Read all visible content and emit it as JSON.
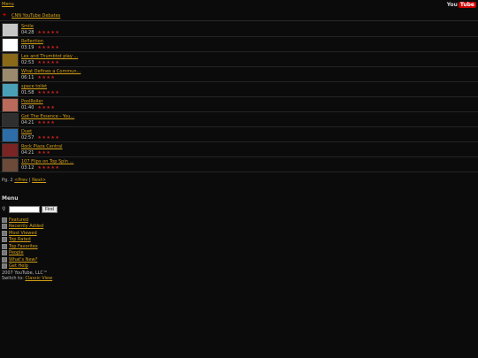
{
  "topbar": {
    "menu_label": "Menu",
    "logo_you": "You",
    "logo_tube": "Tube"
  },
  "playlist": {
    "title": "CNN YouTube Debates"
  },
  "videos": [
    {
      "title": "Smile",
      "duration": "04:28",
      "rating": "★★★★★",
      "thumb_color": "#c7c7c7"
    },
    {
      "title": "Reflection",
      "duration": "03:19",
      "rating": "★★★★★",
      "thumb_color": "#ffffff"
    },
    {
      "title": "Lex and Thumbtot play ...",
      "duration": "02:53",
      "rating": "★★★★★",
      "thumb_color": "#8a6a18"
    },
    {
      "title": "What Defines a Commun...",
      "duration": "06:11",
      "rating": "★★★★",
      "thumb_color": "#9c8a6e"
    },
    {
      "title": "space toilet",
      "duration": "01:58",
      "rating": "★★★★★",
      "thumb_color": "#4aa1b7"
    },
    {
      "title": "PoolRoller",
      "duration": "01:40",
      "rating": "★★★★",
      "thumb_color": "#b96a5b"
    },
    {
      "title": "Got The Essence - You...",
      "duration": "04:21",
      "rating": "★★★★",
      "thumb_color": "#2f2f2f"
    },
    {
      "title": "Duet",
      "duration": "02:57",
      "rating": "★★★★★",
      "thumb_color": "#2d6ea8"
    },
    {
      "title": "Rock Plaza Central",
      "duration": "04:21",
      "rating": "★★★",
      "thumb_color": "#7a2424"
    },
    {
      "title": "107 Flips on Top Spin ...",
      "duration": "03:12",
      "rating": "★★★★★",
      "thumb_color": "#6b4a3a"
    }
  ],
  "pager": {
    "page_text": "Pg. 2",
    "prev_label": "<Prev",
    "sep": "|",
    "next_label": "Next>"
  },
  "menu": {
    "title": "Menu",
    "search_button": "Find",
    "items": [
      {
        "label": "Featured"
      },
      {
        "label": "Recently Added"
      },
      {
        "label": "Most Viewed"
      },
      {
        "label": "Top Rated"
      },
      {
        "label": "Top Favorites"
      },
      {
        "label": "People"
      },
      {
        "label": "What's New?"
      },
      {
        "label": "Get Help"
      }
    ]
  },
  "footer": {
    "copyright": "2007 YouTube, LLC™",
    "switch_text": "Switch to:",
    "classic_label": "Classic View"
  }
}
